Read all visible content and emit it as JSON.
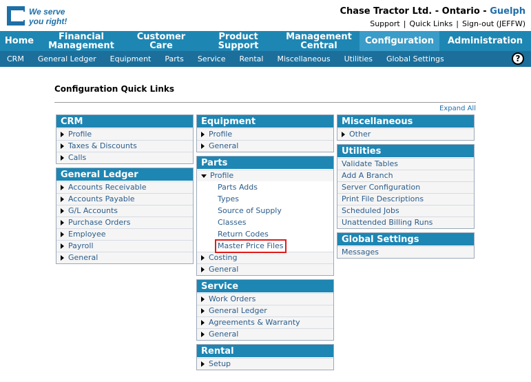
{
  "brand": {
    "tagline_line1": "We serve",
    "tagline_line2": "you right!",
    "accent": "#1e86b3"
  },
  "company": {
    "name": "Chase Tractor Ltd. - Ontario - ",
    "location": "Guelph"
  },
  "toplinks": [
    "Support",
    "Quick Links",
    "Sign-out (JEFFW)"
  ],
  "mainnav": [
    {
      "label": "Home"
    },
    {
      "label": "Financial Management"
    },
    {
      "label": "Customer Care"
    },
    {
      "label": "Product Support"
    },
    {
      "label": "Management Central"
    },
    {
      "label": "Configuration"
    },
    {
      "label": "Administration"
    }
  ],
  "subnav": [
    "CRM",
    "General Ledger",
    "Equipment",
    "Parts",
    "Service",
    "Rental",
    "Miscellaneous",
    "Utilities",
    "Global Settings"
  ],
  "help": "?",
  "page": {
    "title": "Configuration Quick Links",
    "expand_all": "Expand All"
  },
  "panels": {
    "crm": {
      "title": "CRM",
      "items": [
        "Profile",
        "Taxes & Discounts",
        "Calls"
      ]
    },
    "gl": {
      "title": "General Ledger",
      "items": [
        "Accounts Receivable",
        "Accounts Payable",
        "G/L Accounts",
        "Purchase Orders",
        "Employee",
        "Payroll",
        "General"
      ]
    },
    "equipment": {
      "title": "Equipment",
      "items": [
        "Profile",
        "General"
      ]
    },
    "parts": {
      "title": "Parts",
      "profile": "Profile",
      "subitems": [
        "Parts Adds",
        "Types",
        "Source of Supply",
        "Classes",
        "Return Codes",
        "Master Price Files"
      ],
      "items": [
        "Costing",
        "General"
      ]
    },
    "service": {
      "title": "Service",
      "items": [
        "Work Orders",
        "General Ledger",
        "Agreements & Warranty",
        "General"
      ]
    },
    "rental": {
      "title": "Rental",
      "items": [
        "Setup"
      ]
    },
    "misc": {
      "title": "Miscellaneous",
      "items": [
        "Other"
      ]
    },
    "utilities": {
      "title": "Utilities",
      "items": [
        "Validate Tables",
        "Add A Branch",
        "Server Configuration",
        "Print File Descriptions",
        "Scheduled Jobs",
        "Unattended Billing Runs"
      ]
    },
    "global": {
      "title": "Global Settings",
      "items": [
        "Messages"
      ]
    }
  }
}
